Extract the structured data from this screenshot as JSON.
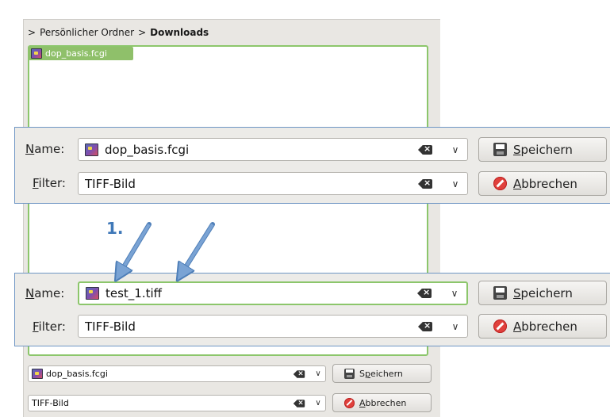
{
  "breadcrumb": {
    "separator": ">",
    "home": "Persönlicher Ordner",
    "current": "Downloads"
  },
  "file_list": {
    "items": [
      {
        "name": "dop_basis.fcgi"
      }
    ]
  },
  "zoom_top": {
    "name_label_first": "N",
    "name_label_rest": "ame:",
    "name_value": "dop_basis.fcgi",
    "filter_label_first": "F",
    "filter_label_rest": "ilter:",
    "filter_value": "TIFF-Bild",
    "save_label_first": "S",
    "save_label_rest": "peichern",
    "cancel_label_first": "A",
    "cancel_label_rest": "bbrechen"
  },
  "annotation": {
    "label": "1."
  },
  "zoom_bottom": {
    "name_label_first": "N",
    "name_label_rest": "ame:",
    "name_value": "test_1.tiff",
    "filter_label_first": "F",
    "filter_label_rest": "ilter:",
    "filter_value": "TIFF-Bild",
    "save_label_first": "S",
    "save_label_rest": "peichern",
    "cancel_label_first": "A",
    "cancel_label_rest": "bbrechen"
  },
  "dialog_bottom": {
    "name_value": "dop_basis.fcgi",
    "filter_value": "TIFF-Bild",
    "save_label_pre": "S",
    "save_label_u": "p",
    "save_label_rest": "eichern",
    "cancel_label_first": "A",
    "cancel_label_rest": "bbrechen"
  },
  "colors": {
    "accent_green": "#8cc66b",
    "annotation_blue": "#3f78b8",
    "arrow_fill": "#7aa3d4",
    "panel_border": "#6f96c4"
  },
  "icons": {
    "file": "image-file-icon",
    "clear": "clear-text-icon",
    "dropdown": "chevron-down-icon",
    "save": "floppy-disk-icon",
    "cancel": "cancel-circle-icon",
    "arrow": "arrow-annotation"
  }
}
